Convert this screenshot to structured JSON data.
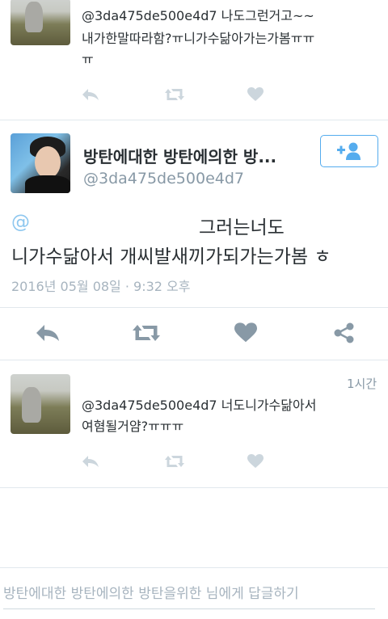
{
  "top_reply": {
    "text_line1": "@3da475de500e4d7 나도그런거고~~",
    "text_line2": "내가한말따라함?ㅠ니가수닮아가는가봄ㅠㅠ",
    "text_line3": "ㅠ"
  },
  "main_tweet": {
    "display_name": "방탄에대한 방탄에의한 방...",
    "handle": "@3da475de500e4d7",
    "at_sign": "@",
    "body_line1": "그러는너도",
    "body_line2": "니가수닮아서 개씨발새끼가되가는가봄 ㅎ",
    "timestamp": "2016년 05월 08일 · 9:32 오후",
    "follow_icon_name": "add-user-icon"
  },
  "bottom_reply": {
    "time_ago": "1시간",
    "text_line1": "@3da475de500e4d7 너도니가수닮아서",
    "text_line2": "여혐될거얌?ㅠㅠㅠ"
  },
  "compose": {
    "placeholder": "방탄에대한 방탄에의한 방탄을위한 님에게 답글하기"
  },
  "colors": {
    "accent": "#55acee",
    "muted": "#8899a6",
    "action_light": "#ccd6dd",
    "action_dark": "#8899a6"
  }
}
